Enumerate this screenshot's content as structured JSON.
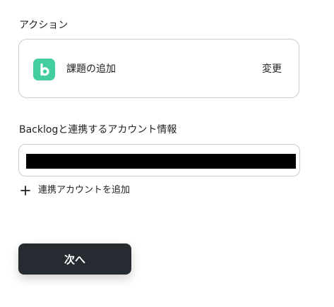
{
  "action_section": {
    "label": "アクション",
    "app_icon": "backlog-logo-icon",
    "action_name": "課題の追加",
    "change_label": "変更"
  },
  "account_section": {
    "label": "Backlogと連携するアカウント情報",
    "add_account_icon": "plus-icon",
    "add_account_label": "連携アカウントを追加"
  },
  "footer": {
    "next_label": "次へ"
  },
  "colors": {
    "app_icon_bg": "#42ce9f",
    "button_bg": "#262a31",
    "border": "#c9ccd1"
  }
}
